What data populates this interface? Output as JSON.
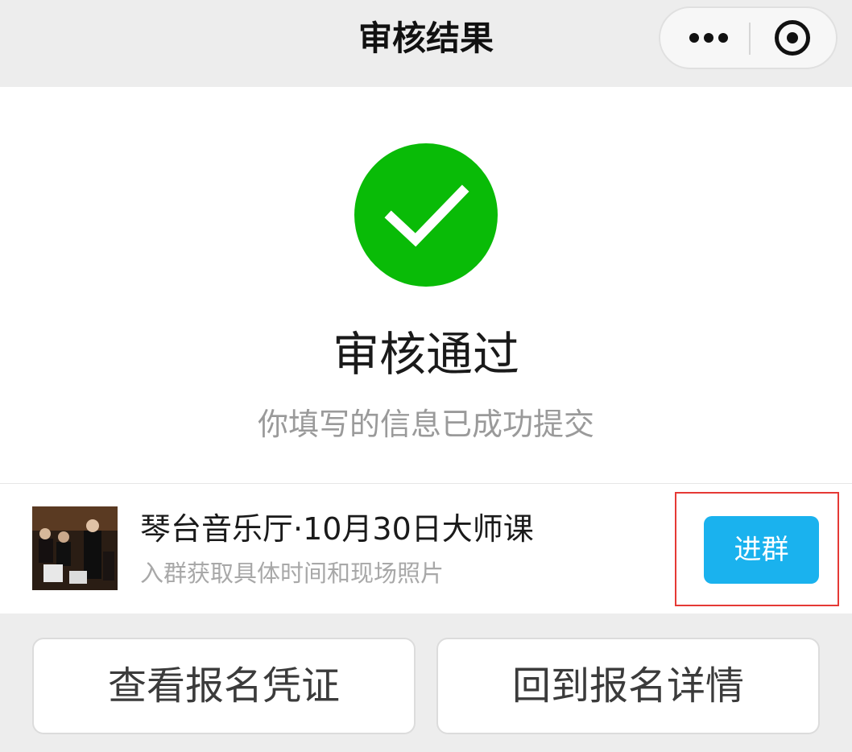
{
  "navbar": {
    "title": "审核结果",
    "more_icon": "more-dots-icon",
    "close_icon": "miniprogram-close-icon"
  },
  "result": {
    "status_icon": "success-check-icon",
    "status_color": "#09bb07",
    "title": "审核通过",
    "description": "你填写的信息已成功提交"
  },
  "group": {
    "title": "琴台音乐厅·10月30日大师课",
    "subtitle": "入群获取具体时间和现场照片",
    "join_label": "进群",
    "join_color": "#1ab2ee",
    "highlight_color": "#e53935"
  },
  "actions": {
    "view_voucher_label": "查看报名凭证",
    "back_to_details_label": "回到报名详情"
  }
}
